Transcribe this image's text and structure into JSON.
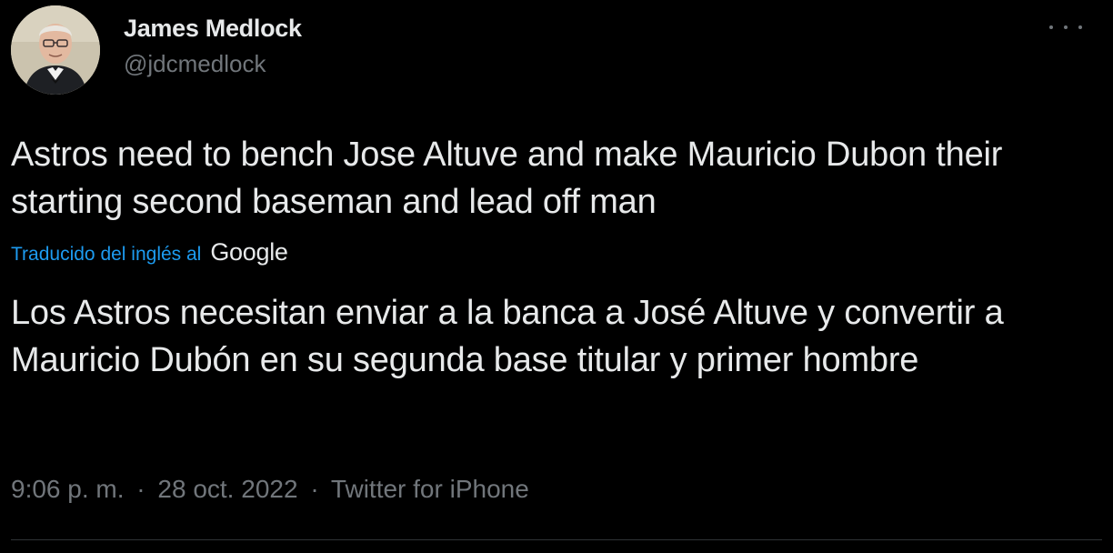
{
  "author": {
    "display_name": "James Medlock",
    "handle": "@jdcmedlock"
  },
  "tweet": {
    "text_original": "Astros need to bench Jose Altuve and make Mauricio Dubon their starting second baseman and lead off man",
    "translation_label": "Traducido del inglés al",
    "translation_provider": "Google",
    "text_translated": "Los Astros necesitan enviar a la banca a José Altuve y convertir a Mauricio Dubón en su segunda base titular y primer hombre",
    "time": "9:06 p. m.",
    "date": "28 oct. 2022",
    "source": "Twitter for iPhone",
    "separator": "·"
  },
  "icons": {
    "more": "more-horizontal-icon",
    "avatar": "profile-photo"
  },
  "colors": {
    "background": "#000000",
    "text": "#e7e9ea",
    "muted": "#71767b",
    "link": "#1d9bf0"
  }
}
